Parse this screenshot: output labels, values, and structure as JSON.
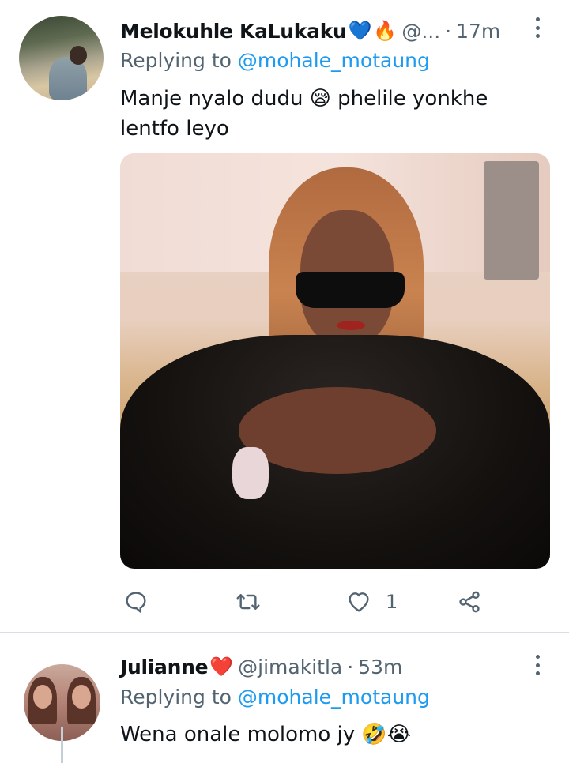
{
  "tweets": [
    {
      "name": "Melokuhle KaLukaku",
      "name_emojis": [
        "💙",
        "🔥"
      ],
      "handle": "@...",
      "separator": "·",
      "time": "17m",
      "replying_prefix": "Replying to",
      "replying_mention": "@mohale_motaung",
      "text": "Manje nyalo dudu 😪 phelile yonkhe lentfo leyo",
      "has_photo": true,
      "actions": {
        "reply_icon": "reply-icon",
        "retweet_icon": "retweet-icon",
        "like_icon": "heart-icon",
        "like_count": "1",
        "share_icon": "share-icon"
      }
    },
    {
      "name": "Julianne",
      "name_emojis": [
        "❤️"
      ],
      "handle": "@jimakitla",
      "separator": "·",
      "time": "53m",
      "replying_prefix": "Replying to",
      "replying_mention": "@mohale_motaung",
      "text": "Wena onale molomo jy 🤣😭"
    }
  ],
  "colors": {
    "accent": "#1d9bf0",
    "secondary_text": "#536471",
    "primary_text": "#0f1419",
    "divider": "#d8dee3"
  }
}
